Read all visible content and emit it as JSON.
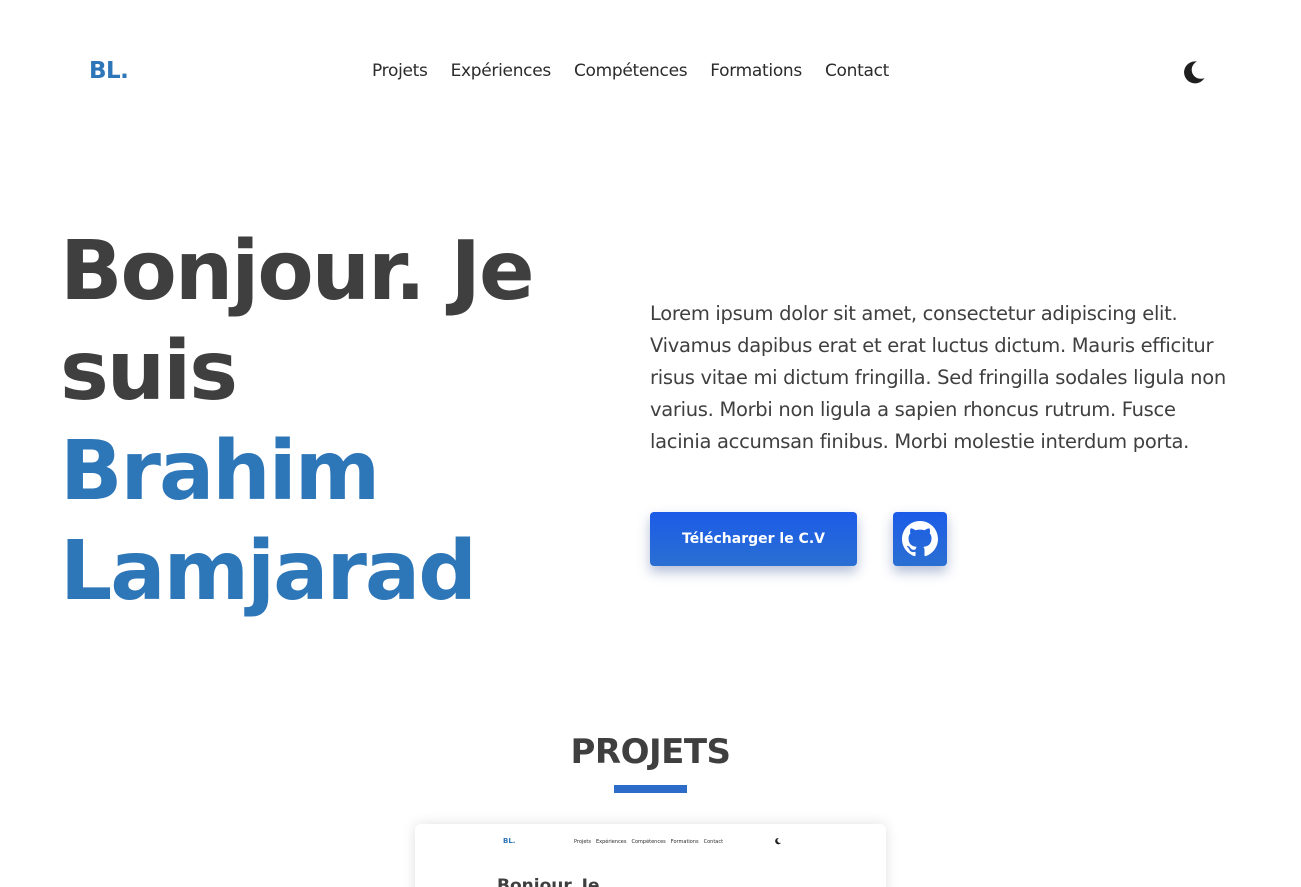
{
  "header": {
    "logo": "BL.",
    "nav": [
      "Projets",
      "Expériences",
      "Compétences",
      "Formations",
      "Contact"
    ],
    "theme_icon": "moon-icon"
  },
  "hero": {
    "greeting": "Bonjour. Je suis",
    "name": "Brahim Lamjarad",
    "description": "Lorem ipsum dolor sit amet, consectetur adipiscing elit. Vivamus dapibus erat et erat luctus dictum. Mauris efficitur risus vitae mi dictum fringilla. Sed fringilla sodales ligula non varius. Morbi non ligula a sapien rhoncus rutrum. Fusce lacinia accumsan finibus. Morbi molestie interdum porta.",
    "cv_button": "Télécharger le C.V",
    "github_icon": "github-icon"
  },
  "projects": {
    "title": "PROJETS",
    "preview": {
      "logo": "BL.",
      "nav": [
        "Projets",
        "Expériences",
        "Compétences",
        "Formations",
        "Contact"
      ],
      "title": "Bonjour. Je"
    }
  },
  "colors": {
    "accent": "#2d76b8",
    "button": "#1c5be8",
    "text": "#3f3f3f"
  }
}
